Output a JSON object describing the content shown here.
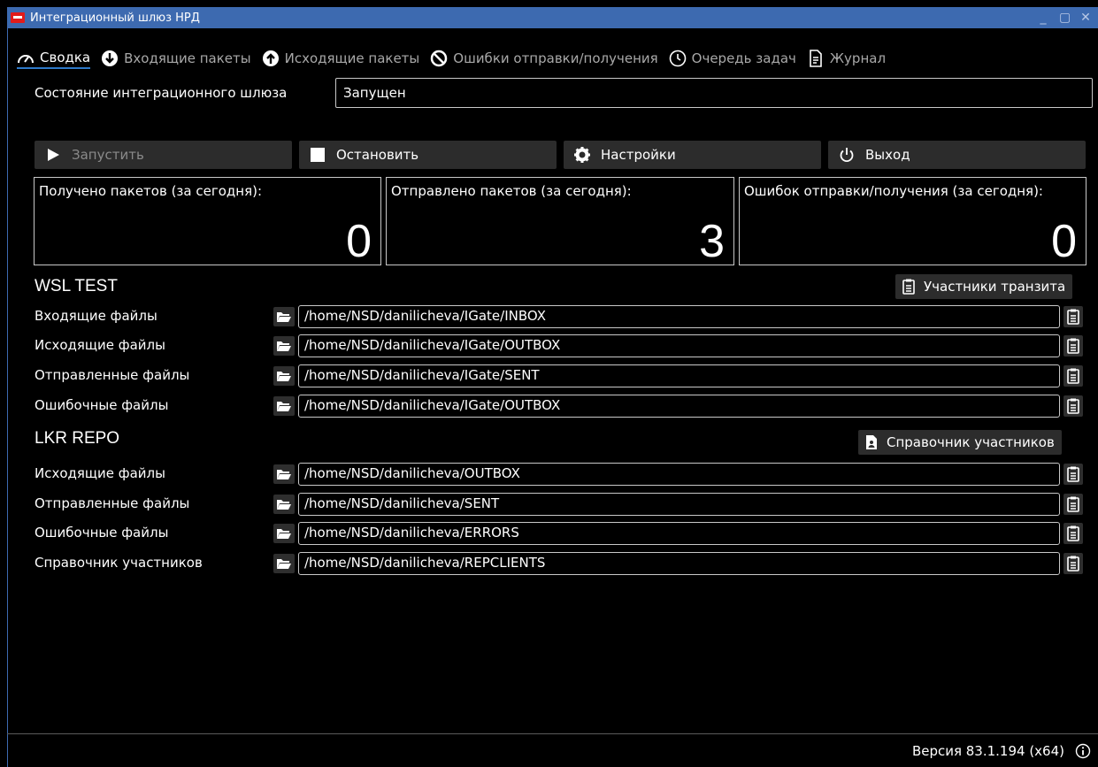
{
  "window": {
    "title": "Интеграционный шлюз НРД"
  },
  "tabs": [
    {
      "label": "Сводка",
      "icon": "gauge-icon",
      "active": true
    },
    {
      "label": "Входящие пакеты",
      "icon": "arrow-down-circle-icon"
    },
    {
      "label": "Исходящие пакеты",
      "icon": "arrow-up-circle-icon"
    },
    {
      "label": "Ошибки отправки/получения",
      "icon": "ban-icon"
    },
    {
      "label": "Очередь задач",
      "icon": "clock-icon"
    },
    {
      "label": "Журнал",
      "icon": "document-icon"
    }
  ],
  "state": {
    "label": "Состояние интеграционного шлюза",
    "value": "Запущен"
  },
  "actions": {
    "start": "Запустить",
    "stop": "Остановить",
    "settings": "Настройки",
    "exit": "Выход"
  },
  "stats": [
    {
      "label": "Получено пакетов (за сегодня):",
      "value": "0"
    },
    {
      "label": "Отправлено пакетов (за сегодня):",
      "value": "3"
    },
    {
      "label": "Ошибок отправки/получения (за сегодня):",
      "value": "0"
    }
  ],
  "wsl": {
    "title": "WSL TEST",
    "button": "Участники транзита",
    "rows": [
      {
        "label": "Входящие файлы",
        "path": "/home/NSD/danilicheva/IGate/INBOX"
      },
      {
        "label": "Исходящие файлы",
        "path": "/home/NSD/danilicheva/IGate/OUTBOX"
      },
      {
        "label": "Отправленные файлы",
        "path": "/home/NSD/danilicheva/IGate/SENT"
      },
      {
        "label": "Ошибочные файлы",
        "path": "/home/NSD/danilicheva/IGate/OUTBOX"
      }
    ]
  },
  "lkr": {
    "title": "LKR REPO",
    "button": "Справочник участников",
    "rows": [
      {
        "label": "Исходящие файлы",
        "path": "/home/NSD/danilicheva/OUTBOX"
      },
      {
        "label": "Отправленные файлы",
        "path": "/home/NSD/danilicheva/SENT"
      },
      {
        "label": "Ошибочные файлы",
        "path": "/home/NSD/danilicheva/ERRORS"
      },
      {
        "label": "Справочник участников",
        "path": "/home/NSD/danilicheva/REPCLIENTS"
      }
    ]
  },
  "status": {
    "version": "Версия 83.1.194 (x64)"
  },
  "colors": {
    "titlebar": "#3d6ab0",
    "accent": "#2e79c9",
    "button": "#2c2c2c",
    "border": "#c8c8c8"
  }
}
